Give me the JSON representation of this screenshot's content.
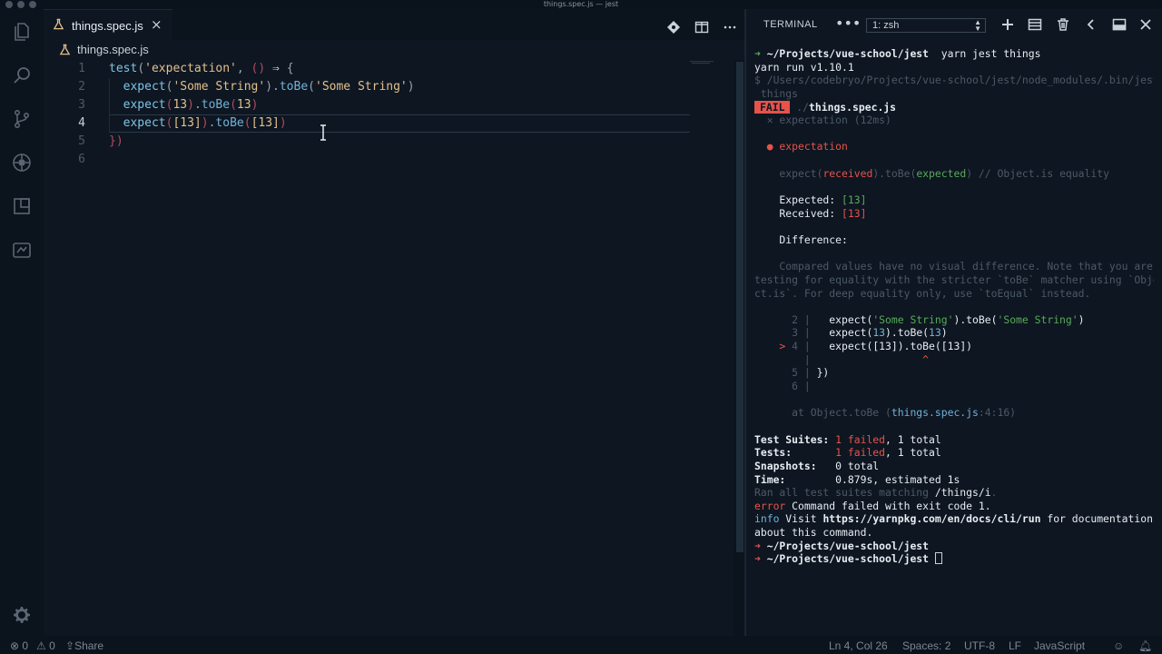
{
  "window": {
    "title": "things.spec.js — jest"
  },
  "editor": {
    "tab_label": "things.spec.js",
    "tab_close": "×",
    "breadcrumb": "things.spec.js",
    "lines": [
      {
        "num": "1",
        "tokens": [
          {
            "t": "test",
            "c": "k-fn"
          },
          {
            "t": "(",
            "c": "k-punc"
          },
          {
            "t": "'expectation'",
            "c": "k-str"
          },
          {
            "t": ", ",
            "c": "k-punc"
          },
          {
            "t": "()",
            "c": "k-paren"
          },
          {
            "t": " ⇒ ",
            "c": "k-arrow"
          },
          {
            "t": "{",
            "c": "k-punc"
          }
        ]
      },
      {
        "num": "2",
        "tokens": [
          {
            "t": "  expect",
            "c": "k-fn"
          },
          {
            "t": "(",
            "c": "k-punc"
          },
          {
            "t": "'Some String'",
            "c": "k-str"
          },
          {
            "t": ").",
            "c": "k-punc"
          },
          {
            "t": "toBe",
            "c": "k-meth"
          },
          {
            "t": "(",
            "c": "k-punc"
          },
          {
            "t": "'Some String'",
            "c": "k-str"
          },
          {
            "t": ")",
            "c": "k-punc"
          }
        ]
      },
      {
        "num": "3",
        "tokens": [
          {
            "t": "  expect",
            "c": "k-fn"
          },
          {
            "t": "(",
            "c": "k-paren"
          },
          {
            "t": "13",
            "c": "k-str"
          },
          {
            "t": ")",
            "c": "k-paren"
          },
          {
            "t": ".",
            "c": "k-punc"
          },
          {
            "t": "toBe",
            "c": "k-meth"
          },
          {
            "t": "(",
            "c": "k-paren"
          },
          {
            "t": "13",
            "c": "k-str"
          },
          {
            "t": ")",
            "c": "k-paren"
          }
        ]
      },
      {
        "num": "4",
        "tokens": [
          {
            "t": "  expect",
            "c": "k-fn"
          },
          {
            "t": "(",
            "c": "k-paren"
          },
          {
            "t": "[13]",
            "c": "k-str"
          },
          {
            "t": ")",
            "c": "k-paren"
          },
          {
            "t": ".",
            "c": "k-punc"
          },
          {
            "t": "toBe",
            "c": "k-meth"
          },
          {
            "t": "(",
            "c": "k-paren"
          },
          {
            "t": "[13]",
            "c": "k-str"
          },
          {
            "t": ")",
            "c": "k-paren"
          }
        ]
      },
      {
        "num": "5",
        "tokens": [
          {
            "t": "})",
            "c": "k-paren"
          }
        ]
      },
      {
        "num": "6",
        "tokens": []
      }
    ],
    "active_line": "4"
  },
  "terminal": {
    "title": "TERMINAL",
    "more": "•••",
    "shell_select": "1: zsh",
    "lines": [
      [
        {
          "t": "➜ ",
          "c": "t-green"
        },
        {
          "t": "~/Projects/vue-school/jest",
          "c": "t-bold"
        },
        {
          "t": "  yarn jest things",
          "c": "t-white"
        }
      ],
      [
        {
          "t": "yarn run v1.10.1",
          "c": "t-white"
        }
      ],
      [
        {
          "t": "$ /Users/codebryo/Projects/vue-school/jest/node_modules/.bin/jest",
          "c": "t-dim"
        }
      ],
      [
        {
          "t": " things",
          "c": "t-dim"
        }
      ],
      [
        {
          "t": "FAIL",
          "c": "fail-badge"
        },
        {
          "t": " ./",
          "c": "t-dim"
        },
        {
          "t": "things.spec.js",
          "c": "t-bold"
        }
      ],
      [
        {
          "t": "  ✕ expectation (12ms)",
          "c": "t-dim"
        }
      ],
      [
        {
          "t": "",
          "c": "t-dim"
        }
      ],
      [
        {
          "t": "  ● expectation",
          "c": "t-red"
        }
      ],
      [
        {
          "t": "",
          "c": "t-dim"
        }
      ],
      [
        {
          "t": "    expect(",
          "c": "t-dim"
        },
        {
          "t": "received",
          "c": "t-red"
        },
        {
          "t": ").toBe(",
          "c": "t-dim"
        },
        {
          "t": "expected",
          "c": "t-green"
        },
        {
          "t": ") // Object.is equality",
          "c": "t-dim"
        }
      ],
      [
        {
          "t": "",
          "c": "t-dim"
        }
      ],
      [
        {
          "t": "    Expected: ",
          "c": "t-white"
        },
        {
          "t": "[13]",
          "c": "t-green"
        }
      ],
      [
        {
          "t": "    Received: ",
          "c": "t-white"
        },
        {
          "t": "[13]",
          "c": "t-red"
        }
      ],
      [
        {
          "t": "",
          "c": "t-dim"
        }
      ],
      [
        {
          "t": "    Difference:",
          "c": "t-white"
        }
      ],
      [
        {
          "t": "",
          "c": "t-dim"
        }
      ],
      [
        {
          "t": "    Compared values have no visual difference. Note that you are",
          "c": "t-dim"
        }
      ],
      [
        {
          "t": "testing for equality with the stricter `toBe` matcher using `Obje",
          "c": "t-dim"
        }
      ],
      [
        {
          "t": "ct.is`. For deep equality only, use `toEqual` instead.",
          "c": "t-dim"
        }
      ],
      [
        {
          "t": "",
          "c": "t-dim"
        }
      ],
      [
        {
          "t": "      2 | ",
          "c": "t-dim"
        },
        {
          "t": "  expect(",
          "c": "t-white"
        },
        {
          "t": "'Some String'",
          "c": "t-green"
        },
        {
          "t": ").toBe(",
          "c": "t-white"
        },
        {
          "t": "'Some String'",
          "c": "t-green"
        },
        {
          "t": ")",
          "c": "t-white"
        }
      ],
      [
        {
          "t": "      3 | ",
          "c": "t-dim"
        },
        {
          "t": "  expect(",
          "c": "t-white"
        },
        {
          "t": "13",
          "c": "t-cyan"
        },
        {
          "t": ").toBe(",
          "c": "t-white"
        },
        {
          "t": "13",
          "c": "t-cyan"
        },
        {
          "t": ")",
          "c": "t-white"
        }
      ],
      [
        {
          "t": "    > ",
          "c": "t-red"
        },
        {
          "t": "4 | ",
          "c": "t-dim"
        },
        {
          "t": "  expect([13]).toBe([13])",
          "c": "t-white"
        }
      ],
      [
        {
          "t": "        | ",
          "c": "t-dim"
        },
        {
          "t": "                 ^",
          "c": "t-red"
        }
      ],
      [
        {
          "t": "      5 | ",
          "c": "t-dim"
        },
        {
          "t": "})",
          "c": "t-white"
        }
      ],
      [
        {
          "t": "      6 | ",
          "c": "t-dim"
        }
      ],
      [
        {
          "t": "",
          "c": "t-dim"
        }
      ],
      [
        {
          "t": "      at Object.toBe (",
          "c": "t-dim"
        },
        {
          "t": "things.spec.js",
          "c": "t-cyan"
        },
        {
          "t": ":4:16)",
          "c": "t-dim"
        }
      ],
      [
        {
          "t": "",
          "c": "t-dim"
        }
      ],
      [
        {
          "t": "Test Suites: ",
          "c": "t-bold"
        },
        {
          "t": "1 failed",
          "c": "t-red"
        },
        {
          "t": ", 1 total",
          "c": "t-white"
        }
      ],
      [
        {
          "t": "Tests:       ",
          "c": "t-bold"
        },
        {
          "t": "1 failed",
          "c": "t-red"
        },
        {
          "t": ", 1 total",
          "c": "t-white"
        }
      ],
      [
        {
          "t": "Snapshots:   ",
          "c": "t-bold"
        },
        {
          "t": "0 total",
          "c": "t-white"
        }
      ],
      [
        {
          "t": "Time:        ",
          "c": "t-bold"
        },
        {
          "t": "0.879s, estimated 1s",
          "c": "t-white"
        }
      ],
      [
        {
          "t": "Ran all test suites matching ",
          "c": "t-dim"
        },
        {
          "t": "/things/i",
          "c": "t-white"
        },
        {
          "t": ".",
          "c": "t-dim"
        }
      ],
      [
        {
          "t": "error",
          "c": "t-red"
        },
        {
          "t": " Command failed with exit code 1.",
          "c": "t-white"
        }
      ],
      [
        {
          "t": "info",
          "c": "t-cyan"
        },
        {
          "t": " Visit ",
          "c": "t-white"
        },
        {
          "t": "https://yarnpkg.com/en/docs/cli/run",
          "c": "t-bold"
        },
        {
          "t": " for documentation",
          "c": "t-white"
        }
      ],
      [
        {
          "t": "about this command.",
          "c": "t-white"
        }
      ],
      [
        {
          "t": "➜ ",
          "c": "t-red"
        },
        {
          "t": "~/Projects/vue-school/jest",
          "c": "t-bold"
        }
      ],
      [
        {
          "t": "➜ ",
          "c": "t-red"
        },
        {
          "t": "~/Projects/vue-school/jest",
          "c": "t-bold"
        },
        {
          "t": " ",
          "c": "t-white"
        }
      ]
    ]
  },
  "statusbar": {
    "errors": "0",
    "warnings": "0",
    "share": "Share",
    "position": "Ln 4, Col 26",
    "spaces": "Spaces: 2",
    "encoding": "UTF-8",
    "eol": "LF",
    "language": "JavaScript"
  },
  "colors": {
    "background": "#0e1621",
    "accent": "#e5534b",
    "keyword": "#7ec4e6",
    "string": "#e2c08d"
  },
  "icons": [
    "files-icon",
    "search-icon",
    "source-control-icon",
    "debug-icon",
    "extensions-icon",
    "remote-icon",
    "gear-icon",
    "flask-icon",
    "split-editor-icon",
    "add-terminal-icon",
    "split-terminal-icon",
    "trash-icon",
    "maximize-icon",
    "close-icon"
  ]
}
